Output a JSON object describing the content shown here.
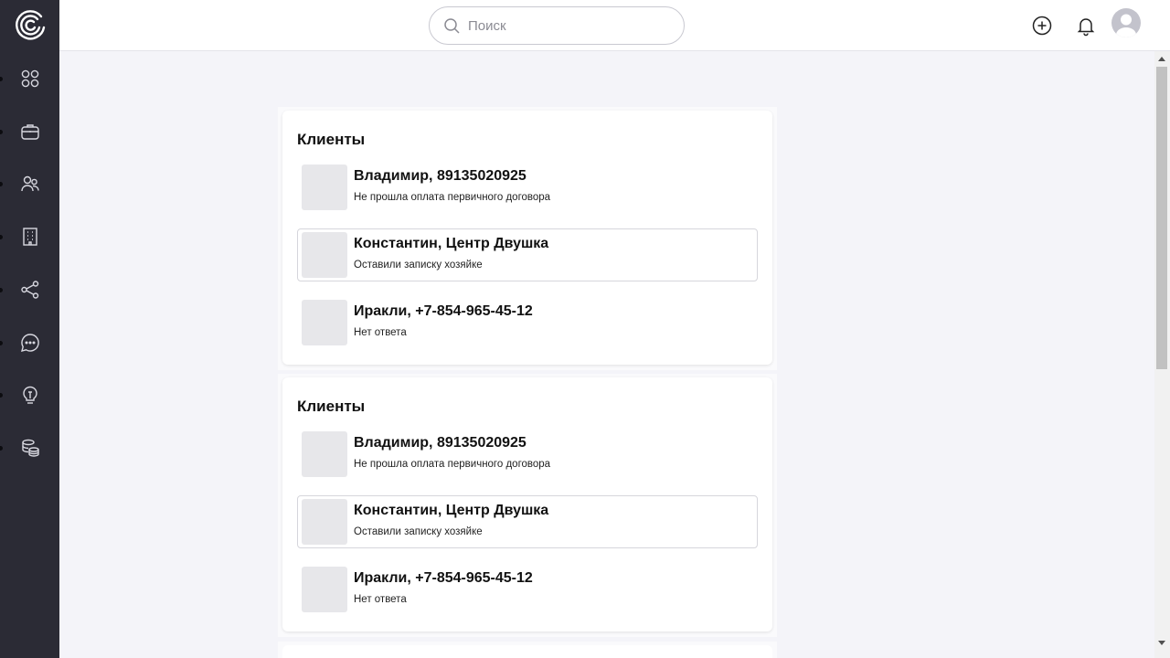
{
  "sidebar": {
    "logo": "app-logo",
    "items": [
      {
        "icon": "dashboard-grid-icon"
      },
      {
        "icon": "briefcase-icon"
      },
      {
        "icon": "users-icon"
      },
      {
        "icon": "building-icon"
      },
      {
        "icon": "share-icon"
      },
      {
        "icon": "chat-icon"
      },
      {
        "icon": "lightbulb-icon"
      },
      {
        "icon": "database-icon"
      }
    ]
  },
  "header": {
    "search_placeholder": "Поиск",
    "search_value": "",
    "icons": [
      "add-circle-icon",
      "bell-icon",
      "user-avatar"
    ]
  },
  "colors": {
    "sidebar_bg": "#2b2b35",
    "page_bg": "#f4f4f9",
    "thumb_bg": "#e7e7ea"
  },
  "cards": [
    {
      "title": "Клиенты",
      "clients": [
        {
          "name": "Владимир, 89135020925",
          "status": "Не прошла оплата первичного договора"
        },
        {
          "name": "Константин, Центр Двушка",
          "status": "Оставили записку хозяйке"
        },
        {
          "name": "Иракли, +7-854-965-45-12",
          "status": "Нет ответа"
        }
      ]
    },
    {
      "title": "Клиенты",
      "clients": [
        {
          "name": "Владимир, 89135020925",
          "status": "Не прошла оплата первичного договора"
        },
        {
          "name": "Константин, Центр Двушка",
          "status": "Оставили записку хозяйке"
        },
        {
          "name": "Иракли, +7-854-965-45-12",
          "status": "Нет ответа"
        }
      ]
    }
  ]
}
